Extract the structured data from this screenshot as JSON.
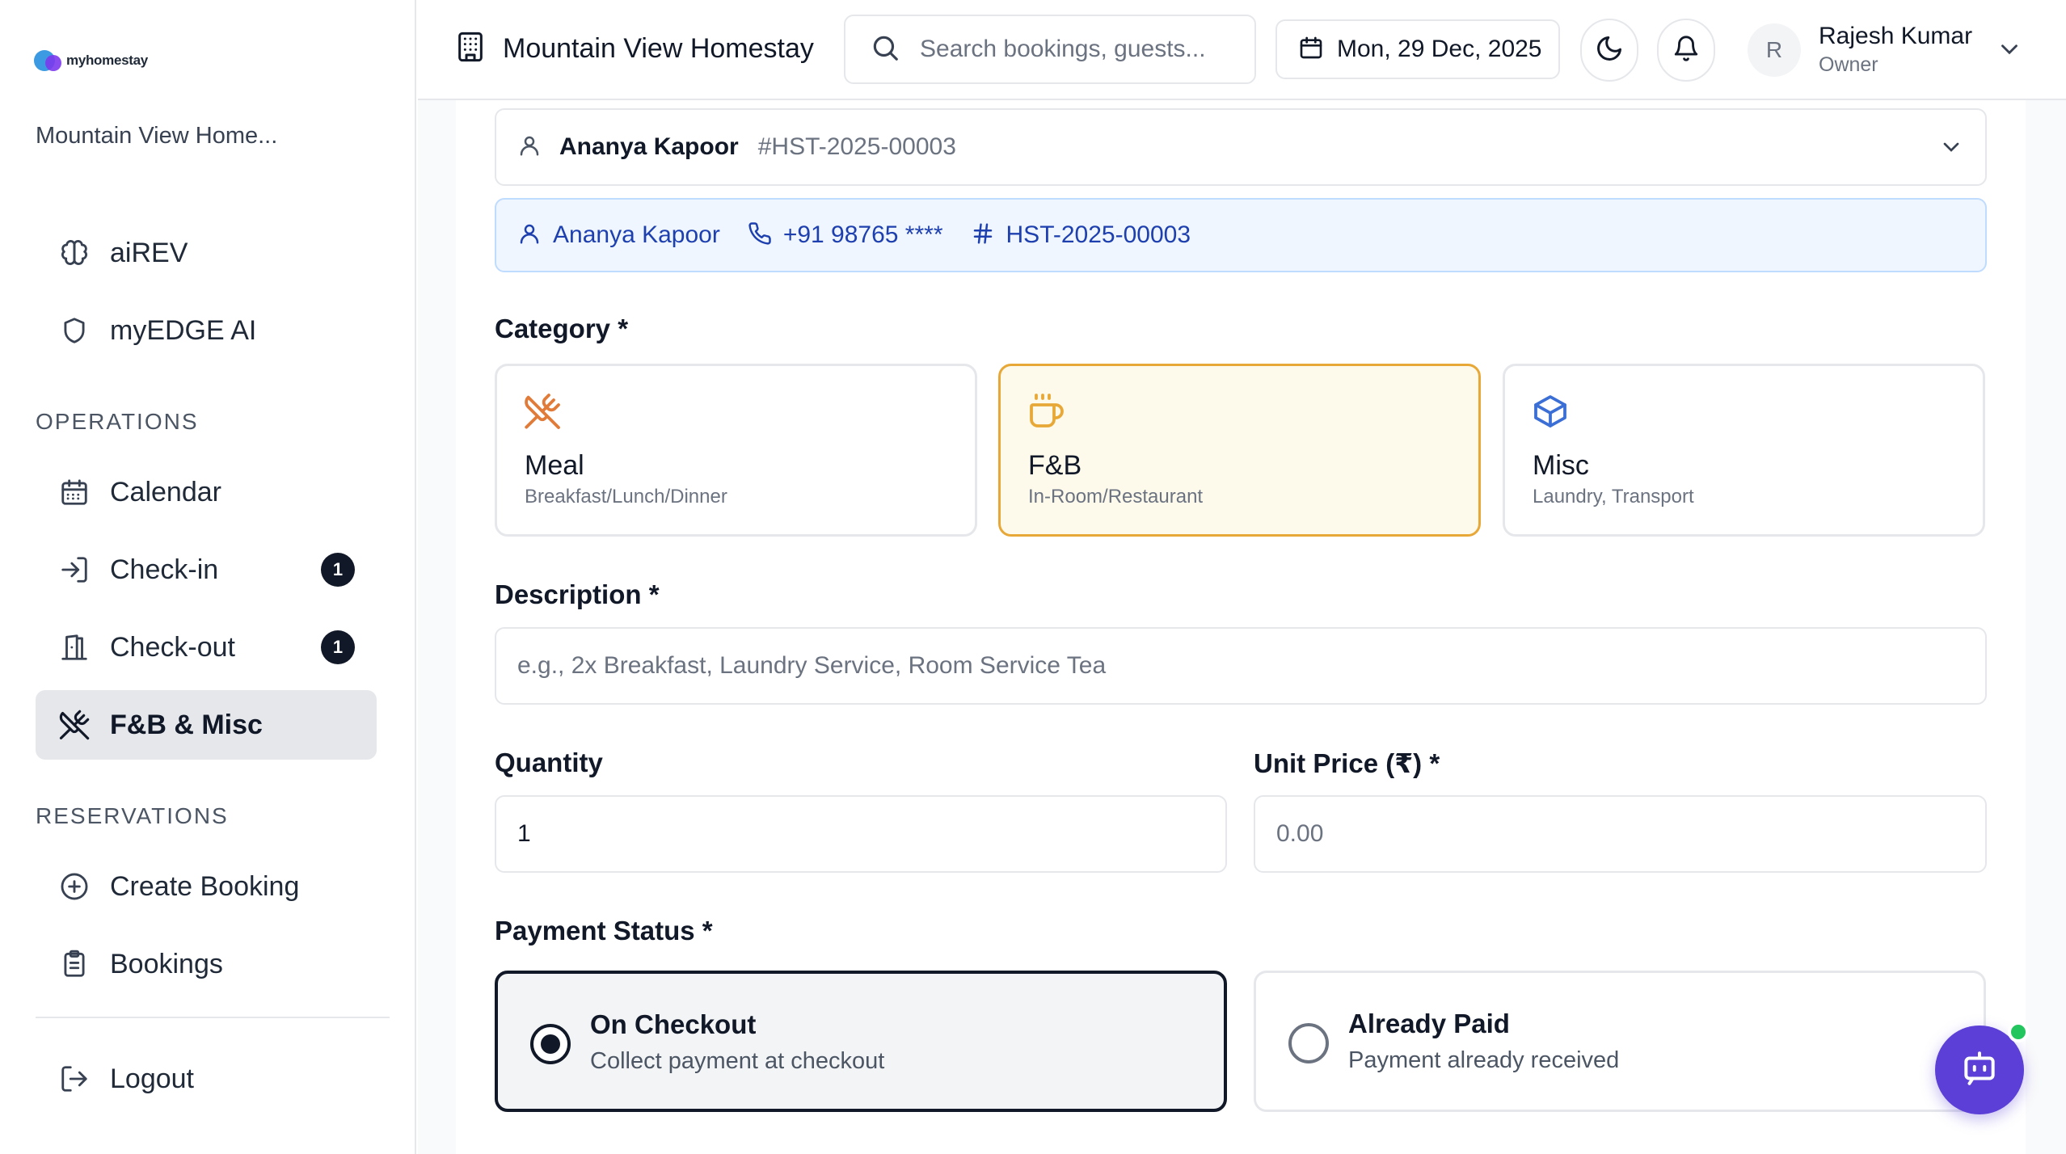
{
  "brand": {
    "logo_text": "myhomestay"
  },
  "sidebar": {
    "property_name": "Mountain View Home...",
    "top_items": [
      {
        "label": "aiREV",
        "icon": "brain-icon"
      },
      {
        "label": "myEDGE AI",
        "icon": "shield-icon"
      }
    ],
    "operations_title": "OPERATIONS",
    "operations": [
      {
        "label": "Calendar",
        "icon": "calendar-icon"
      },
      {
        "label": "Check-in",
        "icon": "login-icon",
        "badge": "1"
      },
      {
        "label": "Check-out",
        "icon": "door-icon",
        "badge": "1"
      },
      {
        "label": "F&B & Misc",
        "icon": "utensils-icon",
        "active": true
      }
    ],
    "reservations_title": "RESERVATIONS",
    "reservations": [
      {
        "label": "Create Booking",
        "icon": "plus-circle-icon"
      },
      {
        "label": "Bookings",
        "icon": "clipboard-icon"
      }
    ],
    "logout_label": "Logout"
  },
  "header": {
    "property_title": "Mountain View Homestay",
    "search_placeholder": "Search bookings, guests...",
    "date": "Mon, 29 Dec, 2025",
    "user_initial": "R",
    "user_name": "Rajesh Kumar",
    "user_role": "Owner"
  },
  "form": {
    "guest": {
      "name": "Ananya Kapoor",
      "booking_id": "#HST-2025-00003"
    },
    "guest_info": {
      "name": "Ananya Kapoor",
      "phone": "+91 98765 ****",
      "booking_ref": "HST-2025-00003"
    },
    "category_label": "Category *",
    "categories": [
      {
        "title": "Meal",
        "subtitle": "Breakfast/Lunch/Dinner",
        "icon": "utensils-crossed-icon",
        "color": "#e07b39"
      },
      {
        "title": "F&B",
        "subtitle": "In-Room/Restaurant",
        "icon": "coffee-icon",
        "color": "#e8a838",
        "selected": true
      },
      {
        "title": "Misc",
        "subtitle": "Laundry, Transport",
        "icon": "package-icon",
        "color": "#3b6fd6"
      }
    ],
    "description_label": "Description *",
    "description_placeholder": "e.g., 2x Breakfast, Laundry Service, Room Service Tea",
    "quantity_label": "Quantity",
    "quantity_value": "1",
    "unit_price_label": "Unit Price (₹) *",
    "unit_price_placeholder": "0.00",
    "payment_label": "Payment Status *",
    "payment_options": [
      {
        "title": "On Checkout",
        "subtitle": "Collect payment at checkout",
        "selected": true
      },
      {
        "title": "Already Paid",
        "subtitle": "Payment already received",
        "selected": false
      }
    ]
  },
  "colors": {
    "accent": "#5b3fd6",
    "selected_border": "#e8a838",
    "info_bg": "#eff6ff",
    "online": "#22c55e"
  }
}
